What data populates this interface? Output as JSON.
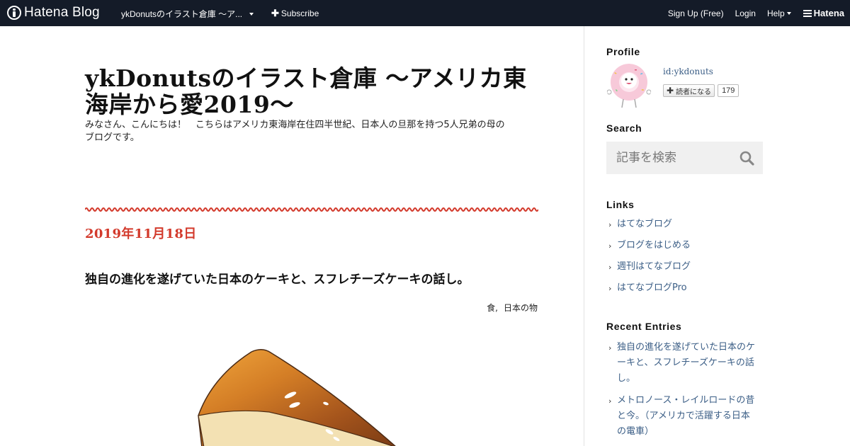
{
  "topbar": {
    "logo_text": "Hatena Blog",
    "blog_name": "ykDonutsのイラスト倉庫 ～ア...",
    "subscribe": "Subscribe",
    "signup": "Sign Up (Free)",
    "login": "Login",
    "help": "Help",
    "hatena": "Hatena"
  },
  "blog": {
    "title": "ykDonutsのイラスト倉庫 ～アメリカ東海岸から愛2019～",
    "description": "みなさん、こんにちは！　こちらはアメリカ東海岸在住四半世紀、日本人の旦那を持つ5人兄弟の母のブログです。"
  },
  "entry": {
    "date": "2019年11月18日",
    "title": "独自の進化を遂げていた日本のケーキと、スフレチーズケーキの話し。",
    "categories": [
      "食",
      "日本の物"
    ]
  },
  "sidebar": {
    "profile": {
      "heading": "Profile",
      "id": "id:ykdonuts",
      "follow_label": "読者になる",
      "follower_count": "179"
    },
    "search": {
      "heading": "Search",
      "placeholder": "記事を検索"
    },
    "links": {
      "heading": "Links",
      "items": [
        "はてなブログ",
        "ブログをはじめる",
        "週刊はてなブログ",
        "はてなブログPro"
      ]
    },
    "recent": {
      "heading": "Recent Entries",
      "items": [
        "独自の進化を遂げていた日本のケーキと、スフレチーズケーキの話し。",
        "メトロノース・レイルロードの昔と今。（アメリカで活躍する日本の電車）"
      ]
    }
  },
  "colors": {
    "topbar_bg": "#141b28",
    "accent_red": "#d33a2c",
    "link_blue": "#3b5e86"
  }
}
